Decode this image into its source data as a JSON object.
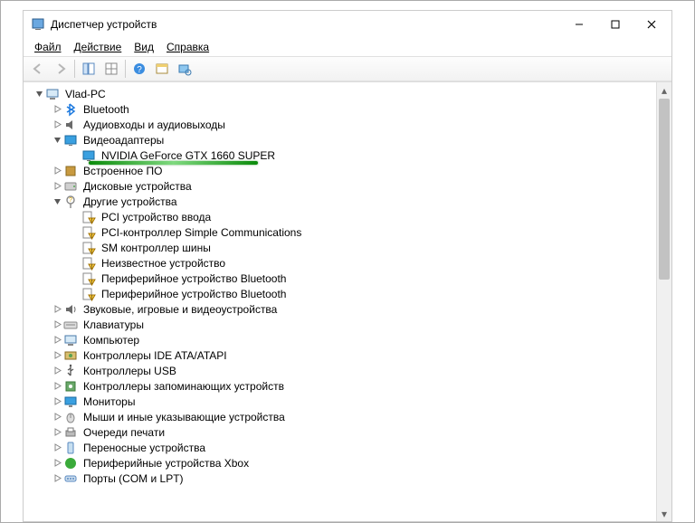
{
  "window": {
    "title": "Диспетчер устройств"
  },
  "menu": {
    "file": "Файл",
    "action": "Действие",
    "view": "Вид",
    "help": "Справка"
  },
  "tree": {
    "root": "Vlad-PC",
    "bluetooth": "Bluetooth",
    "audio": "Аудиовходы и аудиовыходы",
    "video_adapters": "Видеоадаптеры",
    "gpu": "NVIDIA GeForce GTX 1660 SUPER",
    "built_in": "Встроенное ПО",
    "disk": "Дисковые устройства",
    "other_devices": "Другие устройства",
    "pci_input": "PCI устройство ввода",
    "pci_simple": "PCI-контроллер Simple Communications",
    "sm_bus": "SM контроллер шины",
    "unknown": "Неизвестное устройство",
    "periph_bt1": "Периферийное устройство Bluetooth",
    "periph_bt2": "Периферийное устройство Bluetooth",
    "sound": "Звуковые, игровые и видеоустройства",
    "keyboards": "Клавиатуры",
    "computer": "Компьютер",
    "ide": "Контроллеры IDE ATA/ATAPI",
    "usb": "Контроллеры USB",
    "storage": "Контроллеры запоминающих устройств",
    "monitors": "Мониторы",
    "mice": "Мыши и иные указывающие устройства",
    "print_queues": "Очереди печати",
    "portable": "Переносные устройства",
    "xbox": "Периферийные устройства Xbox",
    "ports": "Порты (COM и LPT)"
  }
}
